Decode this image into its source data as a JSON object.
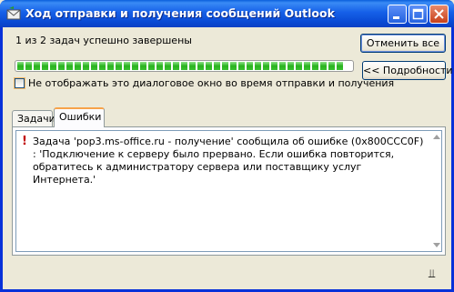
{
  "window": {
    "title": "Ход отправки и получения сообщений Outlook"
  },
  "status_text": "1 из 2 задач успешно завершены",
  "buttons": {
    "cancel_all": "Отменить все",
    "details": "<< Подробности"
  },
  "progress": {
    "fraction": 1.0
  },
  "checkbox": {
    "label": "Не отображать это диалоговое окно во время отправки и получения",
    "checked": false
  },
  "tabs": [
    {
      "label": "Задачи",
      "selected": false
    },
    {
      "label": "Ошибки",
      "selected": true
    }
  ],
  "errors": [
    {
      "icon": "exclamation-icon",
      "text": "Задача 'pop3.ms-office.ru - получение' сообщила об ошибке (0x800CCC0F) : 'Подключение к серверу было прервано. Если ошибка повторится, обратитесь к администратору сервера или поставщику услуг Интернета.'"
    }
  ],
  "colors": {
    "titlebar": "#0a4ad4",
    "progress_fill": "#29b21f",
    "error_icon": "#c00000",
    "tab_highlight": "#f7a34a"
  }
}
